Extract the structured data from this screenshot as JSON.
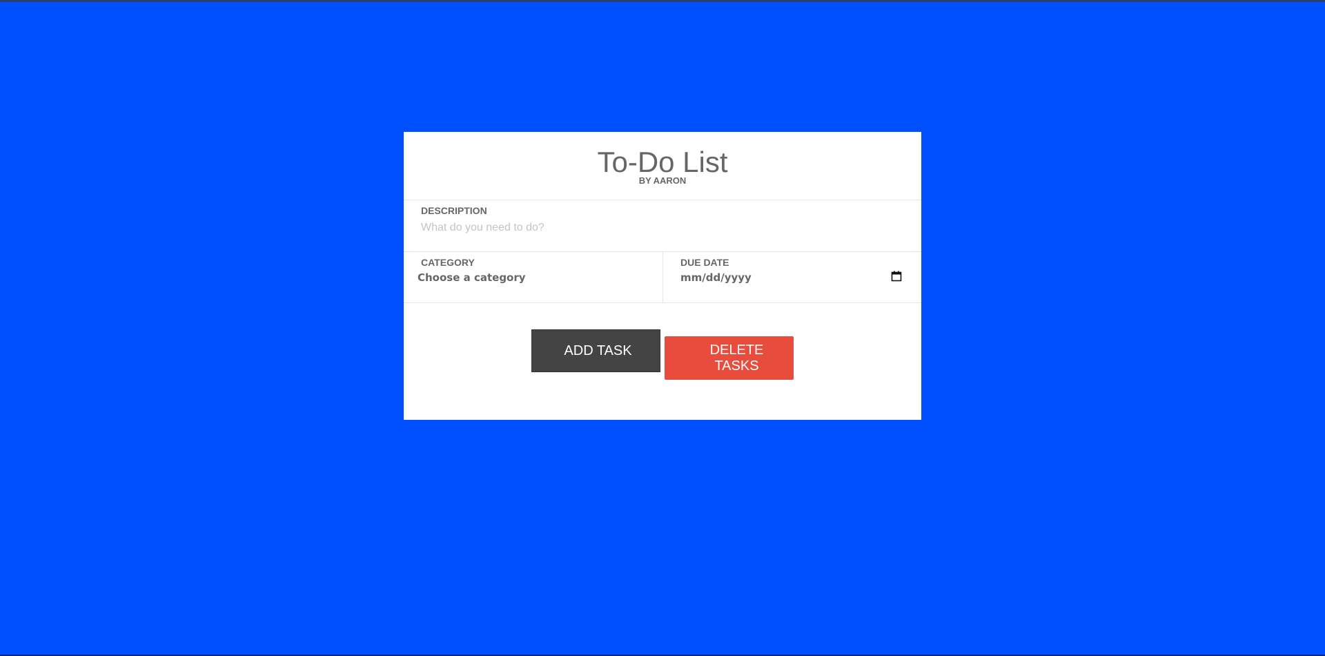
{
  "app": {
    "title": "To-Do List",
    "subtitle": "BY AARON"
  },
  "form": {
    "description": {
      "label": "DESCRIPTION",
      "placeholder": "What do you need to do?",
      "value": ""
    },
    "category": {
      "label": "CATEGORY",
      "selected": "Choose a category"
    },
    "due_date": {
      "label": "DUE DATE",
      "value": "mm/dd/yyyy",
      "icon": "calendar-icon"
    }
  },
  "actions": {
    "add_label": "ADD TASK",
    "delete_label_line1": "DELETE",
    "delete_label_line2": "TASKS"
  },
  "colors": {
    "background": "#0050ff",
    "card": "#ffffff",
    "text": "#666666",
    "add_button": "#444444",
    "delete_button": "#e74c3c"
  }
}
